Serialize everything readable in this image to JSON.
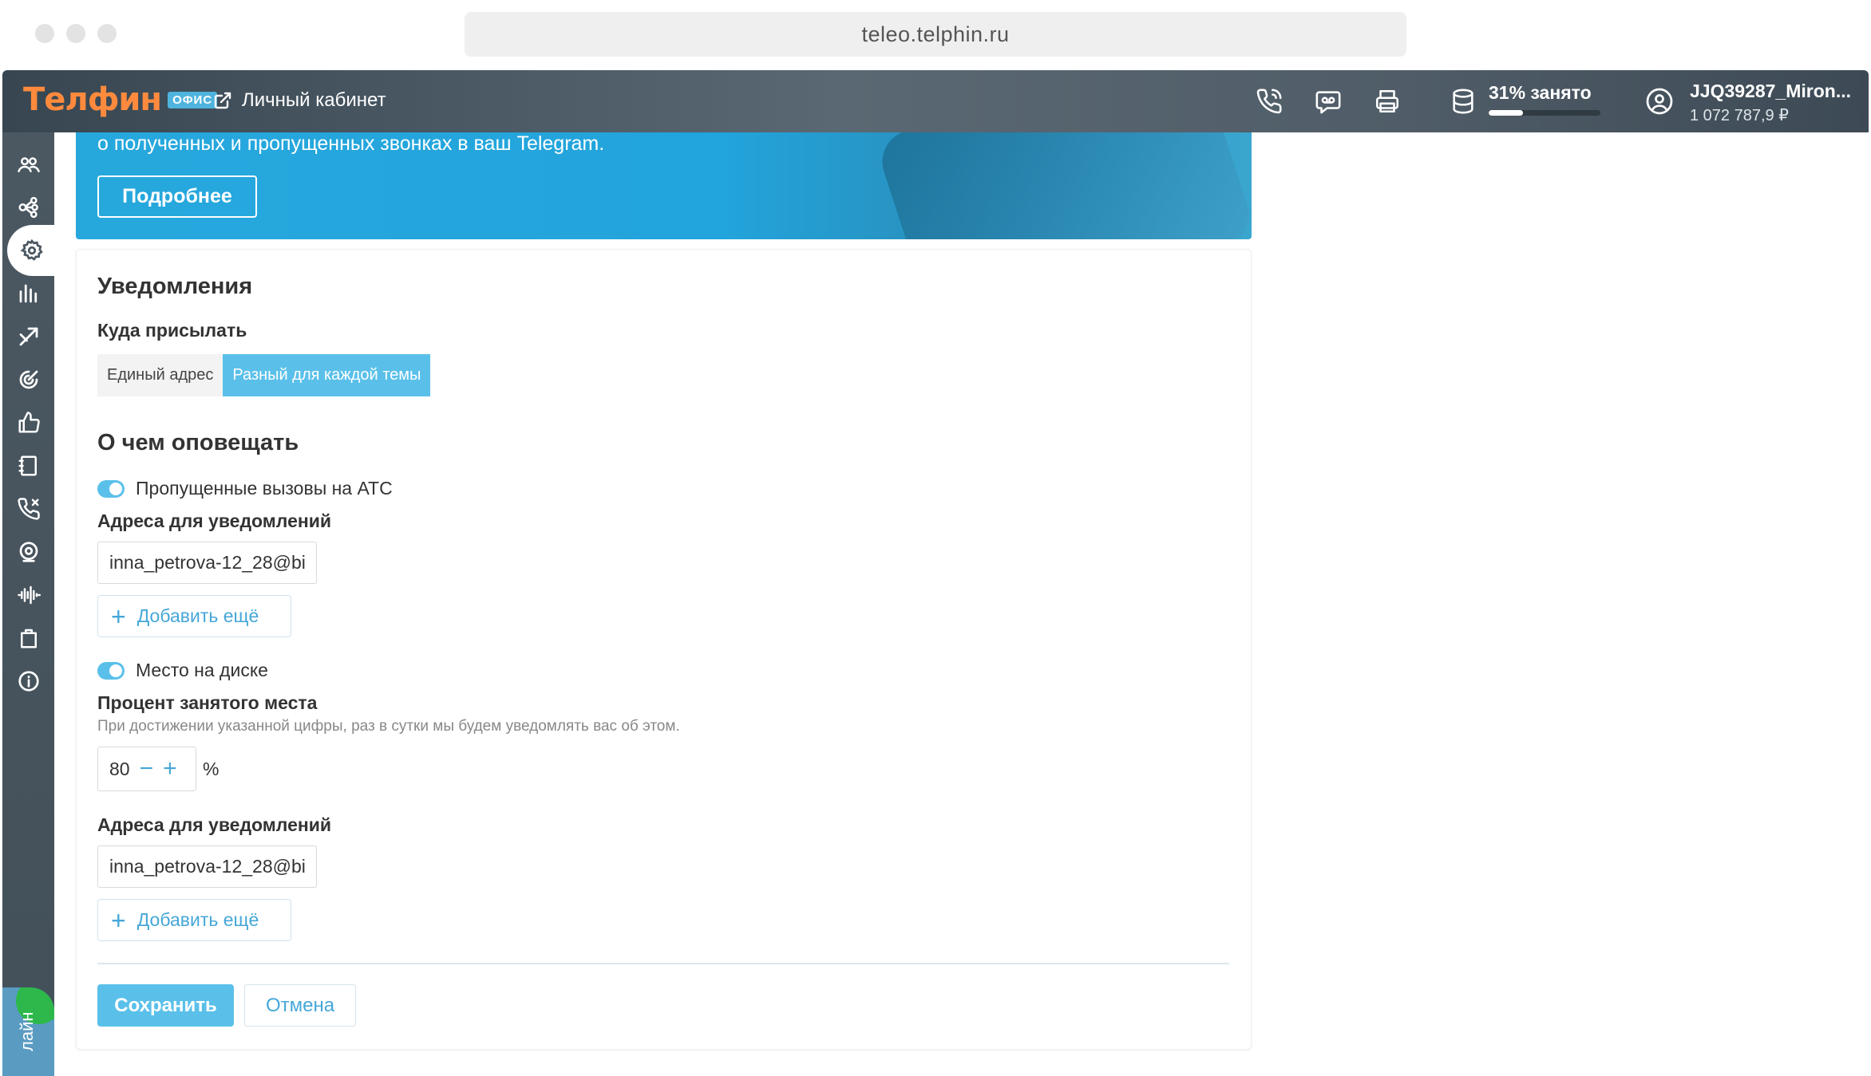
{
  "browser": {
    "url": "teleo.telphin.ru"
  },
  "header": {
    "logo_text": "Телфин",
    "logo_badge": "ОФИС",
    "cabinet_link": "Личный кабинет",
    "disk_usage_label": "31% занято",
    "disk_usage_percent": 31,
    "user_name": "JJQ39287_Miron...",
    "user_balance": "1 072 787,9 ₽"
  },
  "sidebar": {
    "items": [
      {
        "icon": "users-icon"
      },
      {
        "icon": "scheme-icon"
      },
      {
        "icon": "settings-icon",
        "active": true
      },
      {
        "icon": "stats-icon"
      },
      {
        "icon": "calls-direction-icon"
      },
      {
        "icon": "target-icon"
      },
      {
        "icon": "thumbs-up-icon"
      },
      {
        "icon": "phonebook-icon"
      },
      {
        "icon": "callback-icon"
      },
      {
        "icon": "webcam-icon"
      },
      {
        "icon": "voice-icon"
      },
      {
        "icon": "shop-icon"
      },
      {
        "icon": "info-icon"
      }
    ],
    "online_label": "лайн"
  },
  "banner": {
    "text": "о полученных и пропущенных звонках в ваш Telegram.",
    "button": "Подробнее"
  },
  "notifications": {
    "title": "Уведомления",
    "where_label": "Куда присылать",
    "where_options": [
      "Единый адрес",
      "Разный для каждой темы"
    ],
    "where_selected": "Разный для каждой темы",
    "what_title": "О чем оповещать",
    "missed_calls": {
      "toggle_label": "Пропущенные вызовы на АТС",
      "enabled": true,
      "addresses_label": "Адреса для уведомлений",
      "address_value": "inna_petrova-12_28@bi",
      "add_more": "Добавить ещё"
    },
    "disk_space": {
      "toggle_label": "Место на диске",
      "enabled": true,
      "percent_label": "Процент занятого места",
      "percent_hint": "При достижении указанной цифры, раз в сутки мы будем уведомлять вас об этом.",
      "percent_value": "80",
      "percent_unit": "%",
      "addresses_label": "Адреса для уведомлений",
      "address_value": "inna_petrova-12_28@bi",
      "add_more": "Добавить ещё"
    },
    "save_button": "Сохранить",
    "cancel_button": "Отмена"
  },
  "colors": {
    "accent": "#5ac0ea",
    "link": "#45a7d8",
    "logo": "#ff8a3d",
    "header_bg": "#4a5762"
  }
}
